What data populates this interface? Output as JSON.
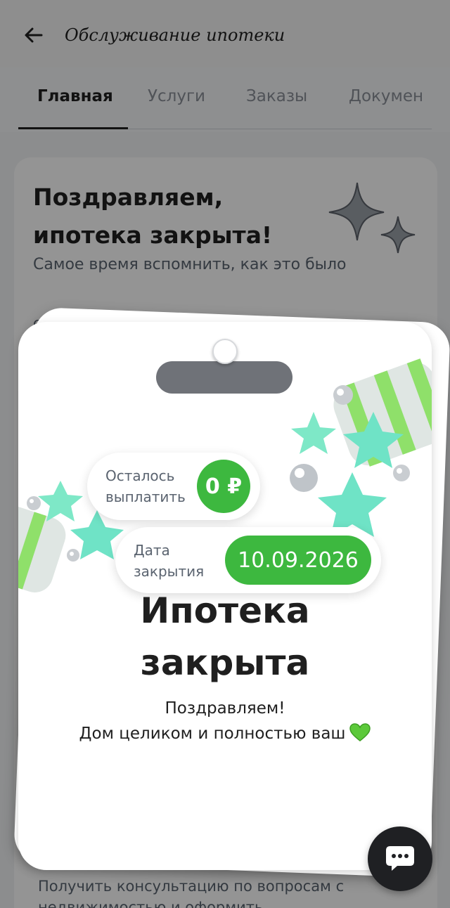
{
  "appbar": {
    "title": "Обслуживание ипотеки",
    "back_icon": "arrow-left-icon"
  },
  "tabs": [
    {
      "label": "Главная",
      "active": true
    },
    {
      "label": "Услуги",
      "active": false
    },
    {
      "label": "Заказы",
      "active": false
    },
    {
      "label": "Докумен",
      "active": false
    }
  ],
  "background_card": {
    "title": "Поздравляем, ипотека закрыта!",
    "subtitle": "Самое время вспомнить, как это было",
    "fragment": "Ос"
  },
  "bottom_promo": {
    "text": "Получить консультацию по вопросам с недвижимостью и оформить"
  },
  "overlay": {
    "remaining": {
      "label": "Осталось выплатить",
      "value": "0 ₽"
    },
    "closing": {
      "label": "Дата закрытия",
      "value": "10.09.2026"
    },
    "title": "Ипотека закрыта",
    "line1": "Поздравляем!",
    "line2": "Дом целиком и полностью ваш",
    "heart_icon": "green-heart-icon"
  },
  "chat_button": {
    "icon": "chat-icon"
  },
  "colors": {
    "accent": "#3db83f",
    "mint": "#6fe3c6",
    "dark": "#1f2023"
  }
}
